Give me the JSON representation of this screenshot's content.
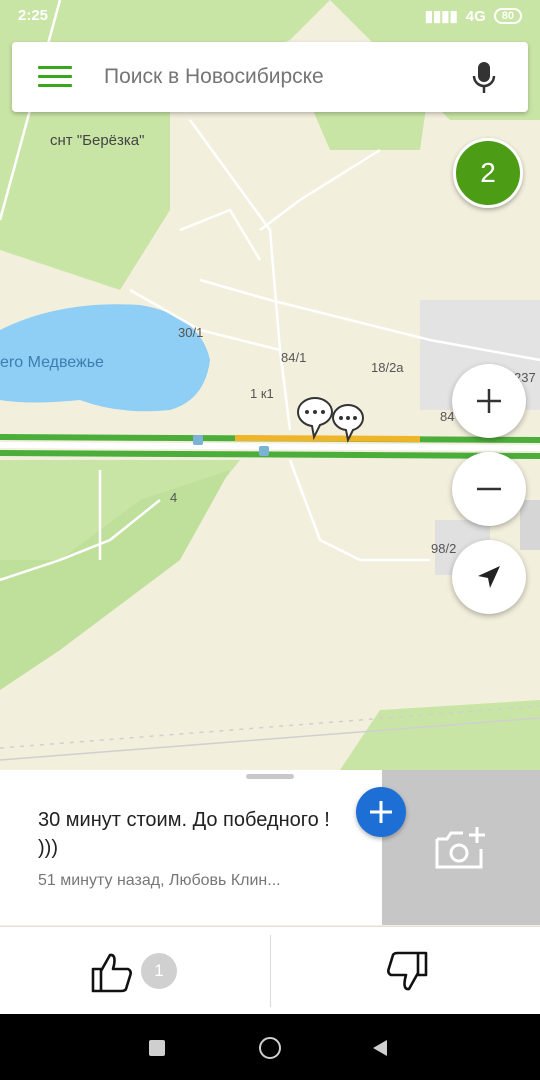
{
  "status": {
    "time": "2:25",
    "network": "4G",
    "battery": "80"
  },
  "search": {
    "placeholder": "Поиск в Новосибирске"
  },
  "layers_badge": "2",
  "map": {
    "labels": [
      "снт \"Берёзка\"",
      "ero Медвежье",
      "30/1",
      "84/1",
      "18/2а",
      "1 к1",
      "84",
      "237",
      "4",
      "98/2"
    ]
  },
  "card": {
    "message": "30 минут стоим. До победного ! )))",
    "meta": "51 минуту назад, Любовь Клин..."
  },
  "votes": {
    "like_count": "1"
  },
  "colors": {
    "accent_green": "#38a71b",
    "badge_green": "#4c9c16",
    "add_blue": "#1d6fd6",
    "jam_yellow": "#f0b429"
  }
}
